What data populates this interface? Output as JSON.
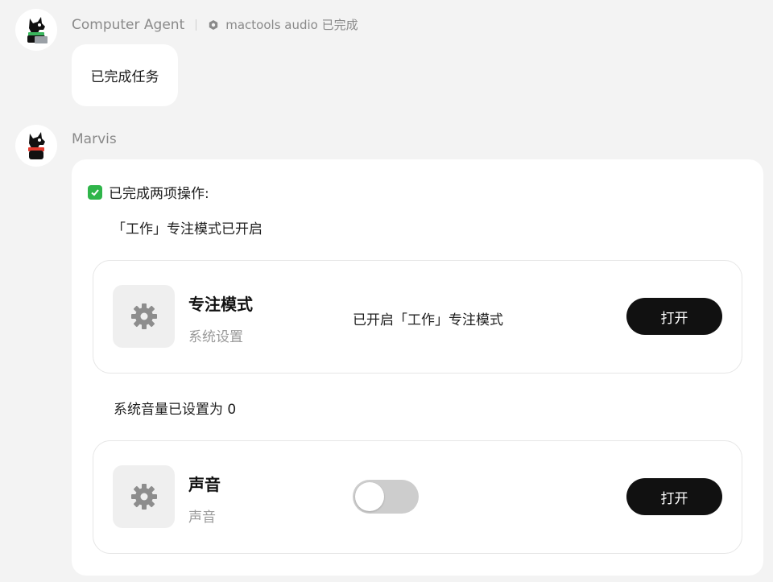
{
  "messages": [
    {
      "sender": "Computer Agent",
      "tool": {
        "icon": "hexagon-icon",
        "label": "mactools audio 已完成"
      },
      "text": "已完成任务"
    },
    {
      "sender": "Marvis",
      "intro": "已完成两项操作:",
      "sections": [
        {
          "text": "「工作」专注模式已开启",
          "card": {
            "icon": "gear-icon",
            "title": "专注模式",
            "subtitle": "系统设置",
            "status": "已开启「工作」专注模式",
            "button": "打开"
          }
        },
        {
          "text": "系统音量已设置为 0",
          "card": {
            "icon": "gear-icon",
            "title": "声音",
            "subtitle": "声音",
            "toggle_on": false,
            "button": "打开"
          }
        }
      ]
    }
  ],
  "colors": {
    "background": "#f3f3f3",
    "button": "#111111",
    "check": "#2fb54a",
    "toggle_off": "#cdcdcd"
  }
}
